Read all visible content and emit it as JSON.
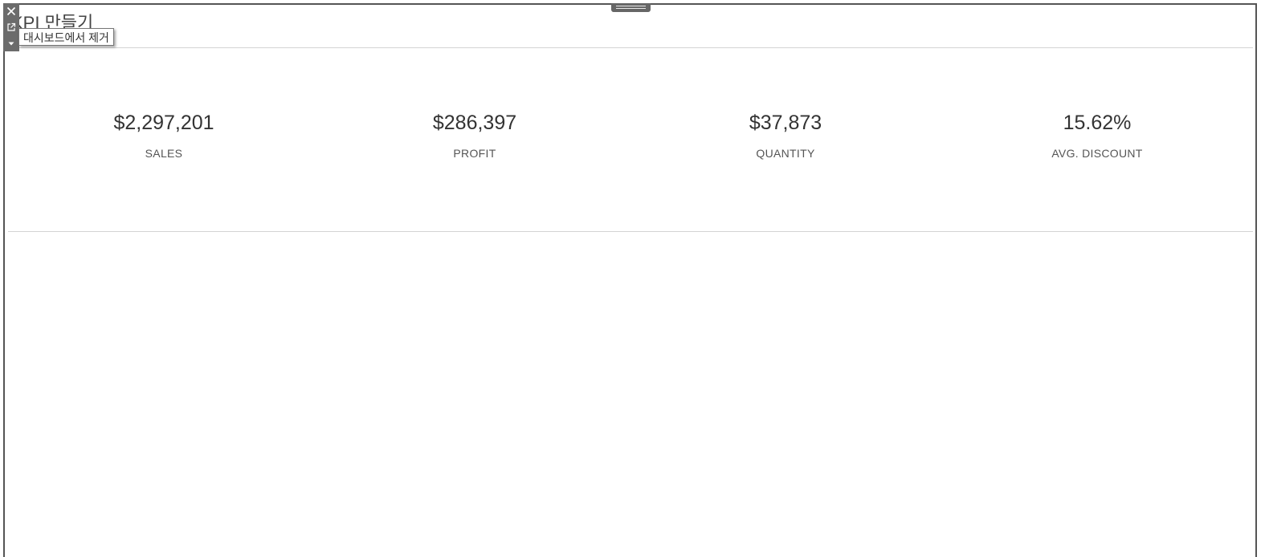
{
  "page": {
    "title": "KPI 만들기"
  },
  "toolbar": {
    "close_icon": "close-icon",
    "open_icon": "external-link-icon",
    "menu_icon": "caret-down-icon",
    "tooltip": "대시보드에서 제거"
  },
  "kpis": [
    {
      "value": "$2,297,201",
      "label": "SALES"
    },
    {
      "value": "$286,397",
      "label": "PROFIT"
    },
    {
      "value": "$37,873",
      "label": "QUANTITY"
    },
    {
      "value": "15.62%",
      "label": "AVG. DISCOUNT"
    }
  ],
  "colors": {
    "text": "#333333",
    "label": "#555555",
    "toolbar": "#6b6b6b",
    "divider": "#d4d4d4"
  }
}
